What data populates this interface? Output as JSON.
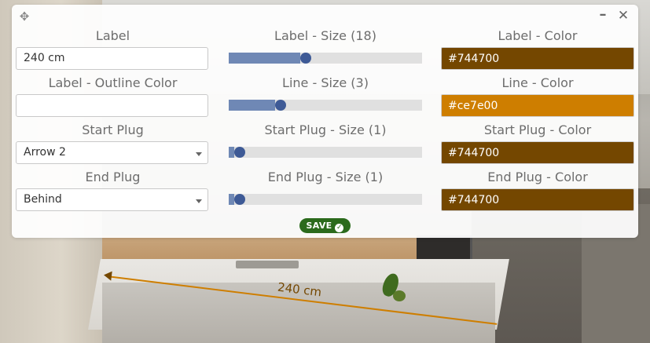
{
  "panel": {
    "save_label": "SAVE",
    "label": {
      "title": "Label",
      "value": "240 cm"
    },
    "label_size": {
      "title": "Label - Size (18)",
      "fraction": 0.37
    },
    "label_color": {
      "title": "Label - Color",
      "value": "#744700",
      "swatch": "#744700"
    },
    "label_outline_color": {
      "title": "Label - Outline Color",
      "value": ""
    },
    "line_size": {
      "title": "Line - Size (3)",
      "fraction": 0.24
    },
    "line_color": {
      "title": "Line - Color",
      "value": "#ce7e00",
      "swatch": "#ce7e00"
    },
    "start_plug": {
      "title": "Start Plug",
      "selected": "Arrow 2"
    },
    "start_plug_size": {
      "title": "Start Plug - Size (1)",
      "fraction": 0.03
    },
    "start_plug_color": {
      "title": "Start Plug - Color",
      "value": "#744700",
      "swatch": "#744700"
    },
    "end_plug": {
      "title": "End Plug",
      "selected": "Behind"
    },
    "end_plug_size": {
      "title": "End Plug - Size (1)",
      "fraction": 0.03
    },
    "end_plug_color": {
      "title": "End Plug - Color",
      "value": "#744700",
      "swatch": "#744700"
    }
  },
  "scene": {
    "dimension_label": "240 cm"
  },
  "icons": {
    "move": "move-icon",
    "minimize": "minimize-icon",
    "close": "close-icon",
    "check": "check-circle-icon",
    "caret": "chevron-down-icon"
  }
}
